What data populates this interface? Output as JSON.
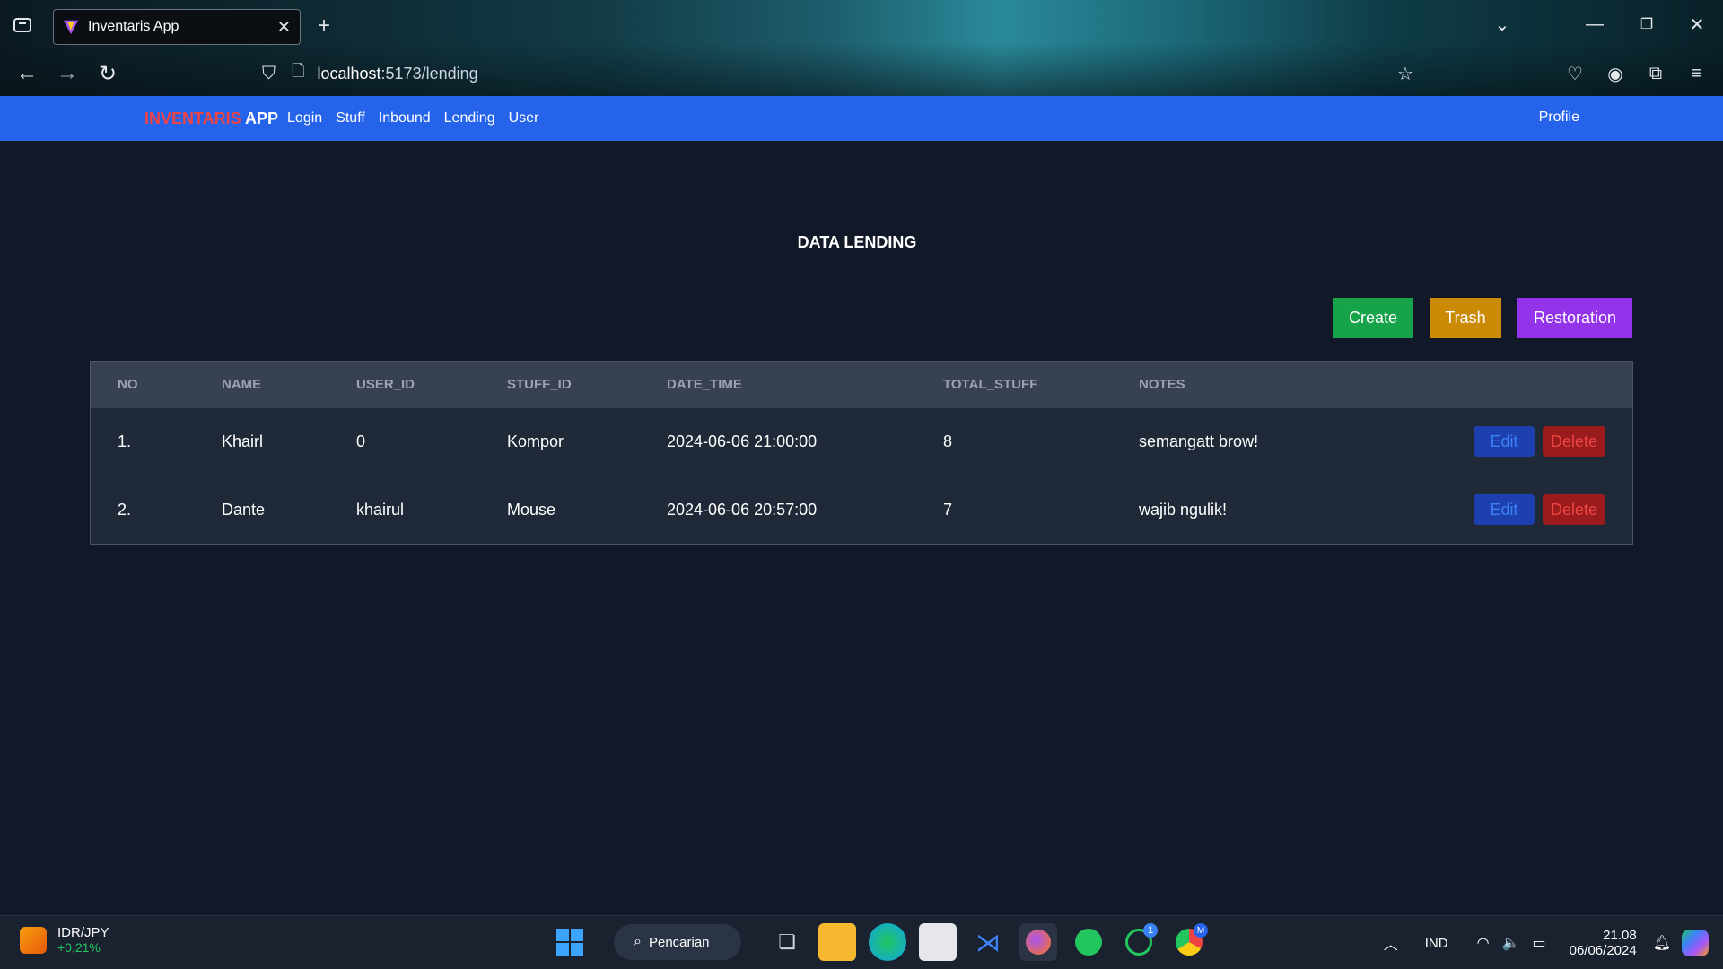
{
  "browser": {
    "tab_title": "Inventaris App",
    "url_host": "localhost",
    "url_path": ":5173/lending"
  },
  "navbar": {
    "brand_part1": "INVENTARIS",
    "brand_part2": " APP",
    "links": [
      "Login",
      "Stuff",
      "Inbound",
      "Lending",
      "User"
    ],
    "profile": "Profile"
  },
  "page": {
    "title": "DATA LENDING",
    "buttons": {
      "create": "Create",
      "trash": "Trash",
      "restoration": "Restoration"
    }
  },
  "table": {
    "headers": [
      "NO",
      "NAME",
      "USER_ID",
      "STUFF_ID",
      "DATE_TIME",
      "TOTAL_STUFF",
      "NOTES"
    ],
    "rows": [
      {
        "no": "1.",
        "name": "Khairl",
        "user_id": "0",
        "stuff_id": "Kompor",
        "date_time": "2024-06-06 21:00:00",
        "total_stuff": "8",
        "notes": "semangatt brow!",
        "edit": "Edit",
        "delete": "Delete"
      },
      {
        "no": "2.",
        "name": "Dante",
        "user_id": "khairul",
        "stuff_id": "Mouse",
        "date_time": "2024-06-06 20:57:00",
        "total_stuff": "7",
        "notes": "wajib ngulik!",
        "edit": "Edit",
        "delete": "Delete"
      }
    ]
  },
  "taskbar": {
    "stock_symbol": "IDR/JPY",
    "stock_change": "+0,21%",
    "search_label": "Pencarian",
    "lang": "IND",
    "time": "21.08",
    "date": "06/06/2024",
    "whatsapp_badge": "1",
    "chrome_badge": "M"
  },
  "colors": {
    "navbar": "#2563eb",
    "background": "#111827",
    "create": "#16a34a",
    "trash": "#ca8a04",
    "restoration": "#9333ea"
  }
}
